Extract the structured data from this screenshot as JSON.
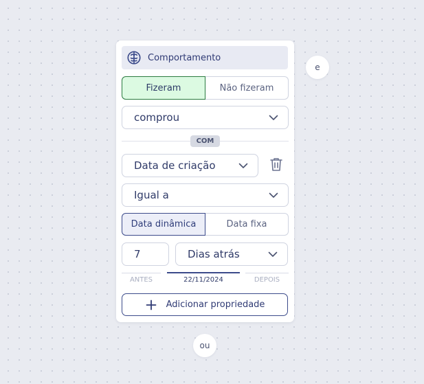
{
  "card": {
    "header": {
      "icon": "brain-icon",
      "title": "Comportamento"
    },
    "performed_toggle": {
      "options": [
        "Fizeram",
        "Não fizeram"
      ],
      "selected": "Fizeram"
    },
    "event_select": {
      "value": "comprou",
      "icon": "chevron-down-icon"
    },
    "with_badge": "COM",
    "property_select": {
      "value": "Data de criação",
      "icon": "chevron-down-icon"
    },
    "delete_icon": "trash-icon",
    "operator_select": {
      "value": "Igual a",
      "icon": "chevron-down-icon"
    },
    "date_type_toggle": {
      "options": [
        "Data dinâmica",
        "Data fixa"
      ],
      "selected": "Data dinâmica"
    },
    "amount_input": {
      "value": "7"
    },
    "unit_select": {
      "value": "Dias atrás",
      "icon": "chevron-down-icon"
    },
    "range": {
      "before_label": "ANTES",
      "date": "22/11/2024",
      "after_label": "DEPOIS"
    },
    "add_property_button": {
      "label": "Adicionar propriedade",
      "icon": "plus-icon"
    }
  },
  "and_bubble": "e",
  "or_bubble": "ou",
  "colors": {
    "accent": "#3b4a8a",
    "active_green_bg": "#dcfae2",
    "active_green_border": "#2a7a3f",
    "canvas_bg": "#e9ebf1"
  }
}
